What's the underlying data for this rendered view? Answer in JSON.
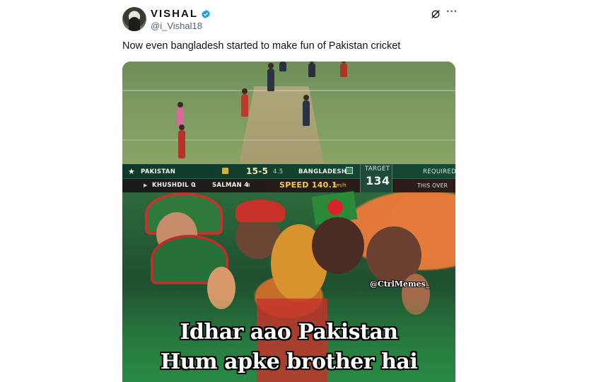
{
  "author": {
    "display_name": "VISHAL",
    "handle": "@i_Vishal18"
  },
  "tweet": {
    "text": "Now even bangladesh started to make fun of Pakistan cricket"
  },
  "icons": {
    "verified": "verified-badge-icon",
    "grok": "grok-icon",
    "more": "more-icon"
  },
  "scoreboard": {
    "team1": "PAKISTAN",
    "score": "15-5",
    "overs": "4.5",
    "team2": "BANGLADESH",
    "target_label": "TARGET",
    "target_value": "134",
    "required_label": "REQUIRED",
    "batter1": "KHUSHDIL 0",
    "batter1_balls": "1",
    "batter2": "SALMAN 4",
    "batter2_balls": "8",
    "speed": "SPEED 140.1",
    "speed_unit": "km/h",
    "this_over": "THIS OVER"
  },
  "meme": {
    "watermark": "@CtrlMemes_",
    "line1": "Idhar aao Pakistan",
    "line2": "Hum apke brother hai"
  },
  "colors": {
    "verified_blue": "#1d9bf0",
    "scoreboard_green": "#0f3b2a",
    "speed_yellow": "#f7c948"
  }
}
